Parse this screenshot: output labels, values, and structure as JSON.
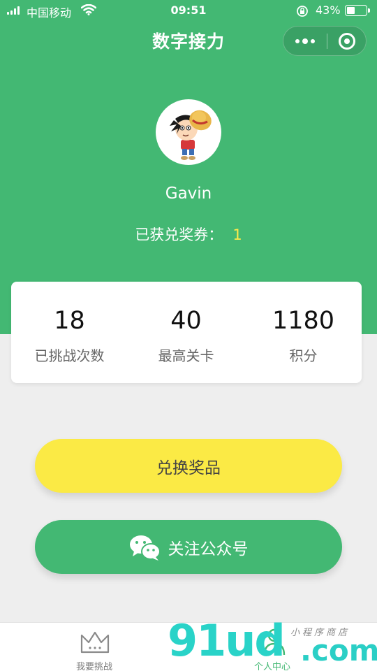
{
  "status_bar": {
    "carrier": "中国移动",
    "time": "09:51",
    "battery": "43%",
    "battery_level": 0.43
  },
  "nav": {
    "title": "数字接力"
  },
  "profile": {
    "username": "Gavin",
    "coupon_label": "已获兑奖券：",
    "coupon_count": "1"
  },
  "stats": [
    {
      "value": "18",
      "label": "已挑战次数"
    },
    {
      "value": "40",
      "label": "最高关卡"
    },
    {
      "value": "1180",
      "label": "积分"
    }
  ],
  "buttons": {
    "redeem": "兑换奖品",
    "follow": "关注公众号"
  },
  "tabs": [
    {
      "label": "我要挑战",
      "icon": "crown-icon"
    },
    {
      "label": "个人中心",
      "icon": "person-icon"
    }
  ],
  "watermark": {
    "brand": "91ud",
    "suffix": ".com",
    "tagline": "小程序商店"
  },
  "colors": {
    "primary_green": "#43b873",
    "accent_yellow": "#fbea45",
    "coupon_yellow": "#ffe94a",
    "background": "#eeeeee",
    "watermark_teal": "#29d3c8"
  }
}
